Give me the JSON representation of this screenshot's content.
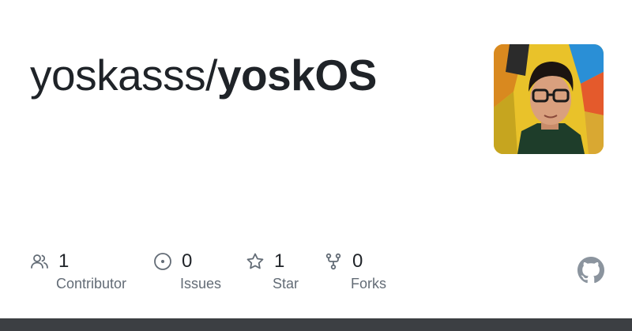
{
  "repo": {
    "owner": "yoskasss/",
    "name": "yoskOS"
  },
  "stats": [
    {
      "icon": "people-icon",
      "count": "1",
      "label": "Contributor"
    },
    {
      "icon": "issue-icon",
      "count": "0",
      "label": "Issues"
    },
    {
      "icon": "star-icon",
      "count": "1",
      "label": "Star"
    },
    {
      "icon": "fork-icon",
      "count": "0",
      "label": "Forks"
    }
  ],
  "colors": {
    "text": "#1f2328",
    "muted": "#636c76",
    "icon": "#636c76",
    "github_mark": "#8b949e",
    "bottom_bar": "#3c3f43"
  },
  "logo": {
    "icon": "github-mark-icon"
  }
}
